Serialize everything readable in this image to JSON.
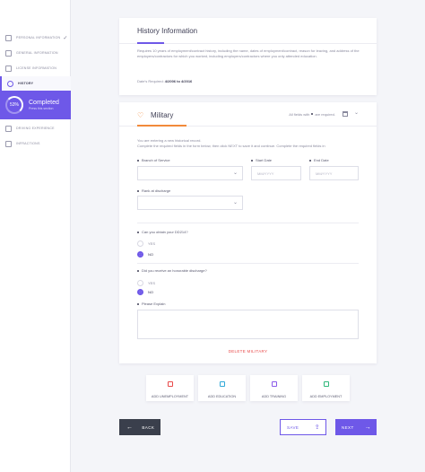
{
  "sidebar": {
    "items": [
      {
        "label": "Personal Information",
        "completed": true
      },
      {
        "label": "General Information"
      },
      {
        "label": "License Information"
      },
      {
        "label": "History",
        "active": true
      },
      {
        "label": "Driving Experience"
      },
      {
        "label": "Infractions"
      }
    ],
    "check_glyph": "✓",
    "progress": {
      "percent_label": "53%",
      "title": "Completed",
      "subtitle": "Press this section"
    }
  },
  "history": {
    "title": "History Information",
    "description": "Requires 10 years of employment/contract history, including the name, dates of employment/contract, reason for leaving, and address of the employers/contractors for which you worked, including employers/contractors where you only attended education.",
    "dates_label": "Date's Required:",
    "dates_value": "4/2006 to 4/2016"
  },
  "military": {
    "icon": "military-badge-icon",
    "title": "Military",
    "required_note_prefix": "All fields with",
    "required_note_suffix": "are required.",
    "intro_line1": "You are entering a new historical record.",
    "intro_line2": "Complete the required fields in the form below, then click NEXT to save it and continue. Complete the required fields in",
    "branch_label": "Branch of Service",
    "start_label": "Start Date",
    "start_placeholder": "MM/YYYY",
    "end_label": "End Date",
    "end_placeholder": "MM/YYYY",
    "rank_label": "Rank at discharge",
    "dd214_question": "Can you obtain your DD214?",
    "honorable_question": "Did you receive an honorable discharge?",
    "yes": "YES",
    "no": "NO",
    "explain_label": "Please Explain",
    "delete": "DELETE MILITARY"
  },
  "add_tiles": [
    {
      "label": "ADD UNEMPLOYMENT",
      "color": "#e84a4a"
    },
    {
      "label": "ADD EDUCATION",
      "color": "#2fa8d8"
    },
    {
      "label": "ADD TRAINING",
      "color": "#8a5ae8"
    },
    {
      "label": "ADD EMPLOYMENT",
      "color": "#2fb87a"
    }
  ],
  "buttons": {
    "back": "BACK",
    "save": "SAVE",
    "next": "NEXT"
  },
  "colors": {
    "accent": "#6e58e8",
    "military": "#f28a3a",
    "danger": "#e84a4a"
  }
}
